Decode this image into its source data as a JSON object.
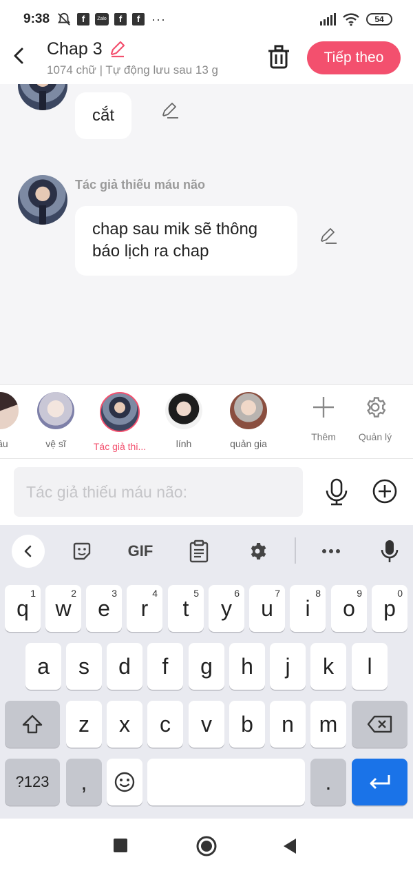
{
  "status_bar": {
    "time": "9:38",
    "notif_label_fb": "f",
    "notif_label_zalo": "Zalo",
    "more": "···",
    "battery": "54"
  },
  "header": {
    "title": "Chap 3",
    "subtitle": "1074 chữ | Tự động lưu sau 13 g",
    "next_label": "Tiếp theo",
    "accent_color": "#f3506e"
  },
  "chat": {
    "messages": [
      {
        "speaker": "",
        "text": "cắt"
      },
      {
        "speaker": "Tác giả thiếu máu não",
        "text_line1": "chap sau mik sẽ thông",
        "text_line2": "báo lịch ra chap"
      }
    ]
  },
  "characters": {
    "items": [
      {
        "name": "nầu"
      },
      {
        "name": "vệ sĩ"
      },
      {
        "name": "Tác giả thi...",
        "selected": true
      },
      {
        "name": "lính"
      },
      {
        "name": "quản gia"
      }
    ],
    "add_label": "Thêm",
    "manage_label": "Quản lý"
  },
  "input": {
    "placeholder": "Tác giả thiếu máu não:",
    "value": ""
  },
  "keyboard": {
    "gif_label": "GIF",
    "row1": [
      {
        "k": "q",
        "n": "1"
      },
      {
        "k": "w",
        "n": "2"
      },
      {
        "k": "e",
        "n": "3"
      },
      {
        "k": "r",
        "n": "4"
      },
      {
        "k": "t",
        "n": "5"
      },
      {
        "k": "y",
        "n": "6"
      },
      {
        "k": "u",
        "n": "7"
      },
      {
        "k": "i",
        "n": "8"
      },
      {
        "k": "o",
        "n": "9"
      },
      {
        "k": "p",
        "n": "0"
      }
    ],
    "row2": [
      "a",
      "s",
      "d",
      "f",
      "g",
      "h",
      "j",
      "k",
      "l"
    ],
    "row3": [
      "z",
      "x",
      "c",
      "v",
      "b",
      "n",
      "m"
    ],
    "symbols_label": "?123",
    "comma": ",",
    "period": "."
  }
}
